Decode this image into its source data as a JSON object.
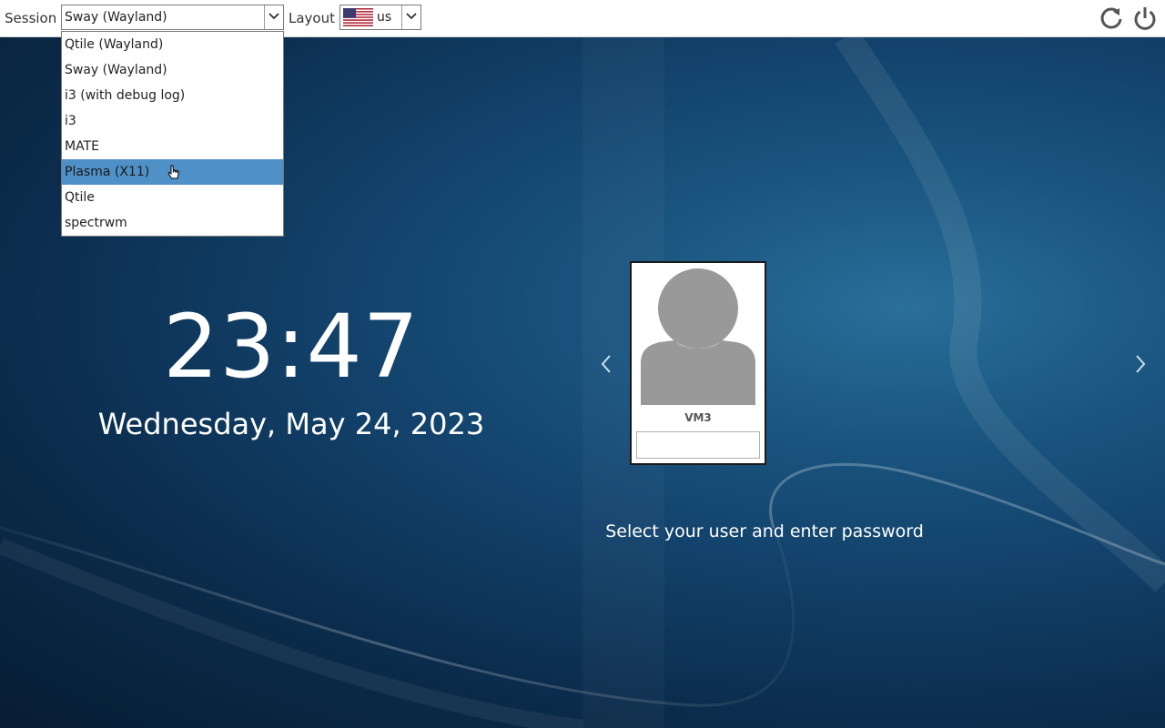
{
  "topbar": {
    "session_label": "Session",
    "session_value": "Sway (Wayland)",
    "layout_label": "Layout",
    "layout_value": "us",
    "reboot_icon": "reboot-icon",
    "shutdown_icon": "power-icon"
  },
  "session_menu": {
    "options": [
      "Qtile (Wayland)",
      "Sway (Wayland)",
      "i3 (with debug log)",
      "i3",
      "MATE",
      "Plasma (X11)",
      "Qtile",
      "spectrwm"
    ],
    "highlighted": "Plasma (X11)"
  },
  "clock": {
    "time": "23:47",
    "date": "Wednesday, May 24, 2023"
  },
  "user": {
    "name": "VM3",
    "password": ""
  },
  "hint": "Select your user and enter password",
  "colors": {
    "highlight": "#4f90c7",
    "background": "#12416a"
  }
}
